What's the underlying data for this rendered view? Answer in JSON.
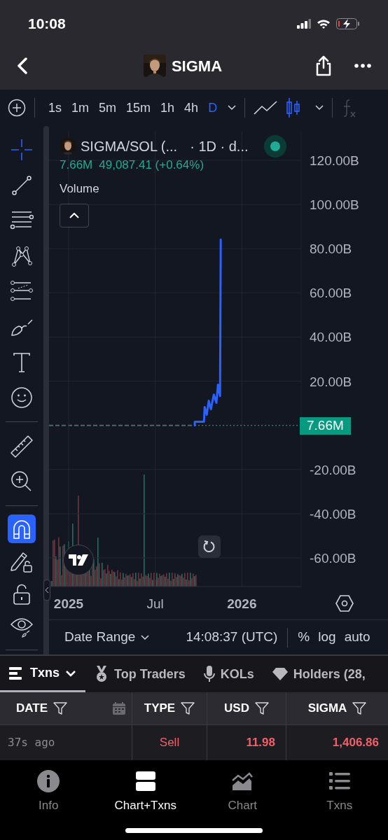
{
  "status_bar": {
    "time": "10:08"
  },
  "header": {
    "title": "SIGMA"
  },
  "toolbar": {
    "timeframes": [
      {
        "label": "1s",
        "selected": false
      },
      {
        "label": "1m",
        "selected": false
      },
      {
        "label": "5m",
        "selected": false
      },
      {
        "label": "15m",
        "selected": false
      },
      {
        "label": "1h",
        "selected": false
      },
      {
        "label": "4h",
        "selected": false
      },
      {
        "label": "D",
        "selected": true
      }
    ],
    "chart_types": [
      {
        "kind": "line",
        "selected": false
      },
      {
        "kind": "candles",
        "selected": true
      }
    ]
  },
  "drawing_tools": [
    {
      "kind": "crosshair",
      "selected": true
    },
    {
      "kind": "trend-line",
      "selected": false
    },
    {
      "kind": "horizontal-lines",
      "selected": false
    },
    {
      "kind": "pattern",
      "selected": false
    },
    {
      "kind": "fib",
      "selected": false
    },
    {
      "kind": "brush",
      "selected": false
    },
    {
      "kind": "text",
      "selected": false
    },
    {
      "kind": "emoji",
      "selected": false
    },
    {
      "kind": "ruler",
      "selected": false
    },
    {
      "kind": "zoom",
      "selected": false
    }
  ],
  "toggle_tools": [
    {
      "kind": "magnet",
      "on": true
    },
    {
      "kind": "draw-lock",
      "on": false
    },
    {
      "kind": "lock",
      "on": false
    },
    {
      "kind": "hide",
      "on": false
    }
  ],
  "chart": {
    "symbol": "SIGMA/SOL (...",
    "interval": "· 1D · d...",
    "live": true,
    "last_value": "7.66M",
    "price_change": "49,087.41 (+0.64%)",
    "indicator": "Volume",
    "price_badge": "7.66M",
    "chart_data": {
      "type": "line",
      "x": [
        2025.728,
        2025.728,
        2025.781,
        2025.785,
        2025.797,
        2025.809,
        2025.821,
        2025.838,
        2025.853,
        2025.862,
        2025.874,
        2025.878
      ],
      "series": [
        {
          "color": "#2962ff",
          "values": [
            0,
            1.6,
            1.6,
            8.3,
            4.8,
            11.1,
            7.3,
            13.9,
            10.2,
            18.4,
            13.3,
            84.1
          ]
        }
      ],
      "xlim": [
        2024.887,
        2026.342
      ],
      "ylim": [
        -73,
        133
      ],
      "grid": true,
      "xticks": [
        {
          "value": 2025,
          "label": "2025"
        },
        {
          "value": 2025.5,
          "label": "Jul"
        },
        {
          "value": 2026,
          "label": "2026"
        }
      ],
      "yticks": [
        {
          "value": 120,
          "label": "120.00B"
        },
        {
          "value": 100,
          "label": "100.00B"
        },
        {
          "value": 80,
          "label": "80.00B"
        },
        {
          "value": 60,
          "label": "60.00B"
        },
        {
          "value": 40,
          "label": "40.00B"
        },
        {
          "value": 20,
          "label": "20.00B"
        },
        {
          "value": -20,
          "label": "-20.00B"
        },
        {
          "value": -40,
          "label": "-40.00B"
        },
        {
          "value": -60,
          "label": "-60.00B"
        }
      ]
    }
  },
  "chart_footer": {
    "date_range": "Date Range",
    "time": "14:08:37 (UTC)",
    "options": [
      "%",
      "log",
      "auto"
    ]
  },
  "tabs": [
    {
      "kind": "list",
      "label": "Txns",
      "selected": true
    },
    {
      "kind": "medal",
      "label": "Top Traders",
      "selected": false
    },
    {
      "kind": "mic",
      "label": "KOLs",
      "selected": false
    },
    {
      "kind": "gem",
      "label": "Holders (28,",
      "selected": false
    }
  ],
  "table": {
    "columns": [
      {
        "label": "DATE",
        "kind": "date"
      },
      {
        "label": "TYPE",
        "kind": "plain"
      },
      {
        "label": "USD",
        "kind": "plain"
      },
      {
        "label": "SIGMA",
        "kind": "plain"
      }
    ],
    "rows": [
      {
        "kind": "sell",
        "date": "37s ago",
        "type": "Sell",
        "usd": "11.98",
        "amount": "1,406.86"
      }
    ]
  },
  "bottom_nav": [
    {
      "kind": "info",
      "label": "Info",
      "selected": false
    },
    {
      "kind": "split",
      "label": "Chart+Txns",
      "selected": true
    },
    {
      "kind": "area",
      "label": "Chart",
      "selected": false
    },
    {
      "kind": "list",
      "label": "Txns",
      "selected": false
    }
  ]
}
